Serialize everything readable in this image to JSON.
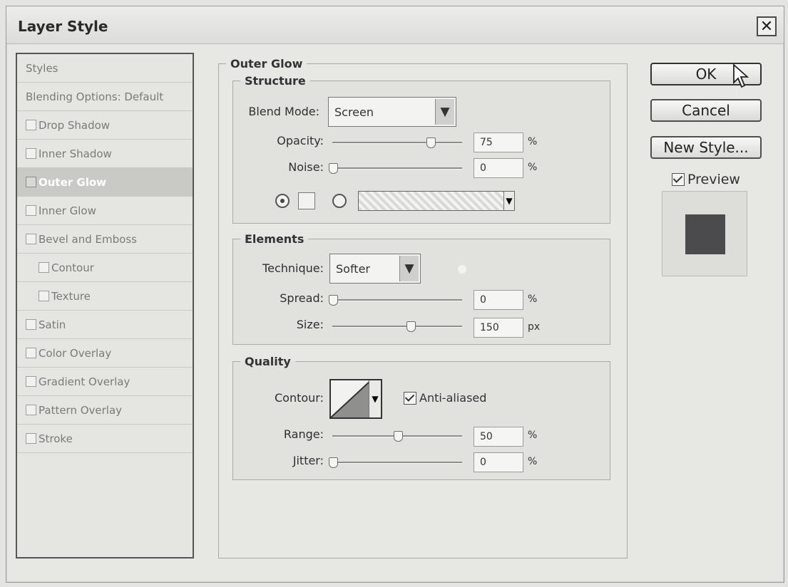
{
  "title": "Layer Style",
  "close_glyph": "✕",
  "styles_list": [
    {
      "label": "Styles",
      "checkbox": false,
      "selected": false,
      "indent": 0
    },
    {
      "label": "Blending Options: Default",
      "checkbox": false,
      "selected": false,
      "indent": 0
    },
    {
      "label": "Drop Shadow",
      "checkbox": true,
      "selected": false,
      "indent": 0
    },
    {
      "label": "Inner Shadow",
      "checkbox": true,
      "selected": false,
      "indent": 0
    },
    {
      "label": "Outer Glow",
      "checkbox": true,
      "selected": true,
      "indent": 0
    },
    {
      "label": "Inner Glow",
      "checkbox": true,
      "selected": false,
      "indent": 0
    },
    {
      "label": "Bevel and Emboss",
      "checkbox": true,
      "selected": false,
      "indent": 0
    },
    {
      "label": "Contour",
      "checkbox": true,
      "selected": false,
      "indent": 1
    },
    {
      "label": "Texture",
      "checkbox": true,
      "selected": false,
      "indent": 1
    },
    {
      "label": "Satin",
      "checkbox": true,
      "selected": false,
      "indent": 0
    },
    {
      "label": "Color Overlay",
      "checkbox": true,
      "selected": false,
      "indent": 0
    },
    {
      "label": "Gradient Overlay",
      "checkbox": true,
      "selected": false,
      "indent": 0
    },
    {
      "label": "Pattern Overlay",
      "checkbox": true,
      "selected": false,
      "indent": 0
    },
    {
      "label": "Stroke",
      "checkbox": true,
      "selected": false,
      "indent": 0
    }
  ],
  "outer_glow": {
    "title": "Outer Glow",
    "structure": {
      "title": "Structure",
      "blend_mode_label": "Blend Mode:",
      "blend_mode_value": "Screen",
      "opacity_label": "Opacity:",
      "opacity_value": "75",
      "opacity_unit": "%",
      "opacity_fraction": 0.75,
      "noise_label": "Noise:",
      "noise_value": "0",
      "noise_unit": "%",
      "noise_fraction": 0,
      "color_mode": "solid"
    },
    "elements": {
      "title": "Elements",
      "technique_label": "Technique:",
      "technique_value": "Softer",
      "spread_label": "Spread:",
      "spread_value": "0",
      "spread_unit": "%",
      "spread_fraction": 0,
      "size_label": "Size:",
      "size_value": "150",
      "size_unit": "px",
      "size_fraction": 0.6
    },
    "quality": {
      "title": "Quality",
      "contour_label": "Contour:",
      "anti_aliased_label": "Anti-aliased",
      "anti_aliased": true,
      "range_label": "Range:",
      "range_value": "50",
      "range_unit": "%",
      "range_fraction": 0.5,
      "jitter_label": "Jitter:",
      "jitter_value": "0",
      "jitter_unit": "%",
      "jitter_fraction": 0
    }
  },
  "buttons": {
    "ok": "OK",
    "cancel": "Cancel",
    "new_style": "New Style..."
  },
  "preview": {
    "label": "Preview",
    "checked": true,
    "swatch_color": "#4b4b4d"
  }
}
